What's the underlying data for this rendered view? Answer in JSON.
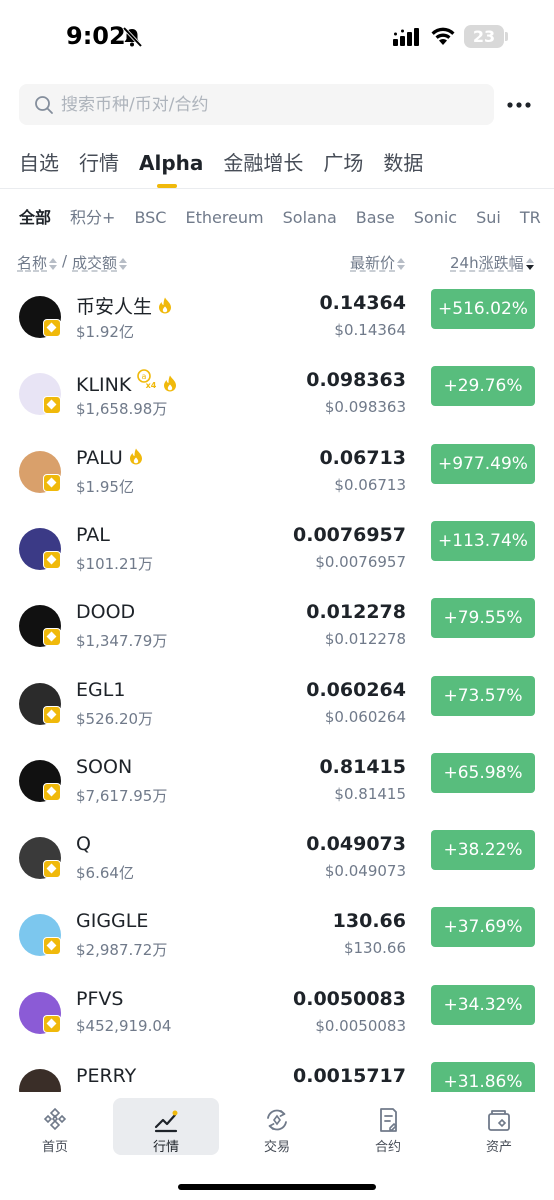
{
  "status_bar": {
    "time": "9:02",
    "battery": "23"
  },
  "search": {
    "placeholder": "搜索币种/币对/合约"
  },
  "main_tabs": [
    {
      "label": "自选"
    },
    {
      "label": "行情"
    },
    {
      "label": "Alpha",
      "active": true
    },
    {
      "label": "金融增长"
    },
    {
      "label": "广场"
    },
    {
      "label": "数据"
    }
  ],
  "chain_tabs": [
    {
      "label": "全部",
      "active": true
    },
    {
      "label": "积分+"
    },
    {
      "label": "BSC"
    },
    {
      "label": "Ethereum"
    },
    {
      "label": "Solana"
    },
    {
      "label": "Base"
    },
    {
      "label": "Sonic"
    },
    {
      "label": "Sui"
    },
    {
      "label": "TR"
    }
  ],
  "columns": {
    "name": "名称",
    "sep": "/",
    "volume": "成交额",
    "price": "最新价",
    "change": "24h涨跌幅"
  },
  "rows": [
    {
      "name": "币安人生",
      "volume": "$1.92亿",
      "price": "0.14364",
      "price_usd": "$0.14364",
      "change": "+516.02%",
      "hot": true,
      "logo_color": "#111111"
    },
    {
      "name": "KLINK",
      "volume": "$1,658.98万",
      "price": "0.098363",
      "price_usd": "$0.098363",
      "change": "+29.76%",
      "hot": true,
      "multiplier": "x4",
      "logo_color": "#e8e4f5"
    },
    {
      "name": "PALU",
      "volume": "$1.95亿",
      "price": "0.06713",
      "price_usd": "$0.06713",
      "change": "+977.49%",
      "hot": true,
      "logo_color": "#d9a06b"
    },
    {
      "name": "PAL",
      "volume": "$101.21万",
      "price": "0.0076957",
      "price_usd": "$0.0076957",
      "change": "+113.74%",
      "logo_color": "#3b3a86"
    },
    {
      "name": "DOOD",
      "volume": "$1,347.79万",
      "price": "0.012278",
      "price_usd": "$0.012278",
      "change": "+79.55%",
      "logo_color": "#111111"
    },
    {
      "name": "EGL1",
      "volume": "$526.20万",
      "price": "0.060264",
      "price_usd": "$0.060264",
      "change": "+73.57%",
      "logo_color": "#2b2b2b"
    },
    {
      "name": "SOON",
      "volume": "$7,617.95万",
      "price": "0.81415",
      "price_usd": "$0.81415",
      "change": "+65.98%",
      "logo_color": "#111111"
    },
    {
      "name": "Q",
      "volume": "$6.64亿",
      "price": "0.049073",
      "price_usd": "$0.049073",
      "change": "+38.22%",
      "logo_color": "#3a3a3a"
    },
    {
      "name": "GIGGLE",
      "volume": "$2,987.72万",
      "price": "130.66",
      "price_usd": "$130.66",
      "change": "+37.69%",
      "logo_color": "#7cc7ee"
    },
    {
      "name": "PFVS",
      "volume": "$452,919.04",
      "price": "0.0050083",
      "price_usd": "$0.0050083",
      "change": "+34.32%",
      "logo_color": "#8b5bd6"
    },
    {
      "name": "PERRY",
      "volume": "",
      "price": "0.0015717",
      "price_usd": "",
      "change": "+31.86%",
      "logo_color": "#3a2e28"
    }
  ],
  "bottom_nav": [
    {
      "label": "首页",
      "icon": "home-icon"
    },
    {
      "label": "行情",
      "icon": "markets-icon",
      "active": true
    },
    {
      "label": "交易",
      "icon": "trade-icon"
    },
    {
      "label": "合约",
      "icon": "futures-icon"
    },
    {
      "label": "资产",
      "icon": "wallet-icon"
    }
  ],
  "colors": {
    "accent": "#f0b90b",
    "up": "#58bd7d",
    "text": "#1e2329",
    "muted": "#707a8a"
  }
}
